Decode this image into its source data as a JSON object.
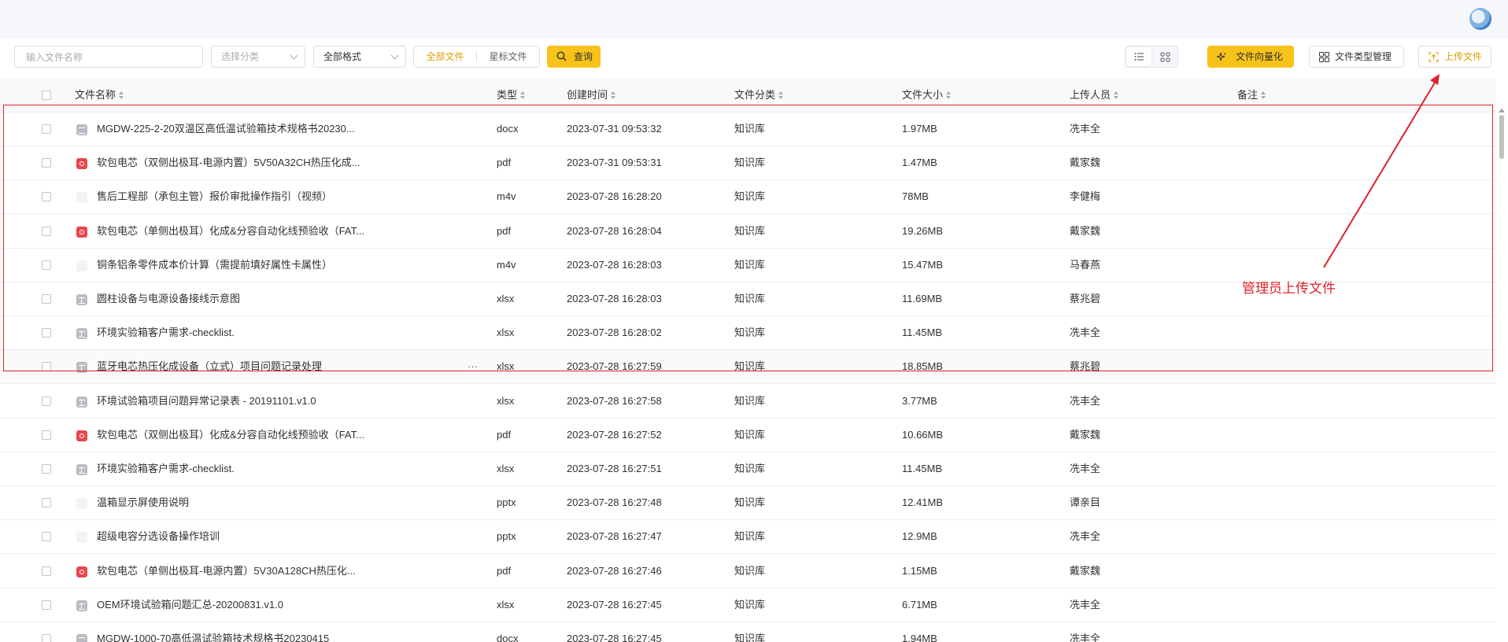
{
  "toolbar": {
    "search_placeholder": "输入文件名称",
    "category_placeholder": "选择分类",
    "format_value": "全部格式",
    "tab_all": "全部文件",
    "tab_star": "星标文件",
    "query_label": "查询",
    "vectorize_label": "文件向量化",
    "type_mgmt_label": "文件类型管理",
    "upload_label": "上传文件"
  },
  "table": {
    "columns": [
      "文件名称",
      "类型",
      "创建时间",
      "文件分类",
      "文件大小",
      "上传人员",
      "备注"
    ],
    "rows": [
      {
        "name": "MGDW-225-2-20双温区高低温试验箱技术规格书20230...",
        "icon": "doc",
        "type": "docx",
        "created": "2023-07-31 09:53:32",
        "category": "知识库",
        "size": "1.97MB",
        "uploader": "冼丰全",
        "note": ""
      },
      {
        "name": "软包电芯（双侧出极耳-电源内置）5V50A32CH热压化成...",
        "icon": "pdf",
        "type": "pdf",
        "created": "2023-07-31 09:53:31",
        "category": "知识库",
        "size": "1.47MB",
        "uploader": "戴家魏",
        "note": ""
      },
      {
        "name": "售后工程部（承包主管）报价审批操作指引（视频）",
        "icon": "vid",
        "type": "m4v",
        "created": "2023-07-28 16:28:20",
        "category": "知识库",
        "size": "78MB",
        "uploader": "李健梅",
        "note": ""
      },
      {
        "name": "软包电芯（单侧出极耳）化成&分容自动化线预验收（FAT...",
        "icon": "pdf",
        "type": "pdf",
        "created": "2023-07-28 16:28:04",
        "category": "知识库",
        "size": "19.26MB",
        "uploader": "戴家魏",
        "note": ""
      },
      {
        "name": "铜条铝条零件成本价计算（需提前填好属性卡属性）",
        "icon": "vid",
        "type": "m4v",
        "created": "2023-07-28 16:28:03",
        "category": "知识库",
        "size": "15.47MB",
        "uploader": "马春燕",
        "note": ""
      },
      {
        "name": "圆柱设备与电源设备接线示意图",
        "icon": "xls",
        "type": "xlsx",
        "created": "2023-07-28 16:28:03",
        "category": "知识库",
        "size": "11.69MB",
        "uploader": "蔡兆碧",
        "note": ""
      },
      {
        "name": "环境实验箱客户需求-checklist.",
        "icon": "xls",
        "type": "xlsx",
        "created": "2023-07-28 16:28:02",
        "category": "知识库",
        "size": "11.45MB",
        "uploader": "冼丰全",
        "note": ""
      },
      {
        "name": "蓝牙电芯热压化成设备（立式）项目问题记录处理",
        "icon": "xls",
        "type": "xlsx",
        "created": "2023-07-28 16:27:59",
        "category": "知识库",
        "size": "18.85MB",
        "uploader": "蔡兆碧",
        "note": ""
      },
      {
        "name": "环境试验箱项目问题异常记录表 - 20191101.v1.0",
        "icon": "xls",
        "type": "xlsx",
        "created": "2023-07-28 16:27:58",
        "category": "知识库",
        "size": "3.77MB",
        "uploader": "冼丰全",
        "note": ""
      },
      {
        "name": "软包电芯（双侧出极耳）化成&分容自动化线预验收（FAT...",
        "icon": "pdf",
        "type": "pdf",
        "created": "2023-07-28 16:27:52",
        "category": "知识库",
        "size": "10.66MB",
        "uploader": "戴家魏",
        "note": ""
      },
      {
        "name": "环境实验箱客户需求-checklist.",
        "icon": "xls",
        "type": "xlsx",
        "created": "2023-07-28 16:27:51",
        "category": "知识库",
        "size": "11.45MB",
        "uploader": "冼丰全",
        "note": ""
      },
      {
        "name": "温箱显示屏使用说明",
        "icon": "ppt",
        "type": "pptx",
        "created": "2023-07-28 16:27:48",
        "category": "知识库",
        "size": "12.41MB",
        "uploader": "谭亲目",
        "note": ""
      },
      {
        "name": "超级电容分选设备操作培训",
        "icon": "ppt",
        "type": "pptx",
        "created": "2023-07-28 16:27:47",
        "category": "知识库",
        "size": "12.9MB",
        "uploader": "冼丰全",
        "note": ""
      },
      {
        "name": "软包电芯（单侧出极耳-电源内置）5V30A128CH热压化...",
        "icon": "pdf",
        "type": "pdf",
        "created": "2023-07-28 16:27:46",
        "category": "知识库",
        "size": "1.15MB",
        "uploader": "戴家魏",
        "note": ""
      },
      {
        "name": "OEM环境试验箱问题汇总-20200831.v1.0",
        "icon": "xls",
        "type": "xlsx",
        "created": "2023-07-28 16:27:45",
        "category": "知识库",
        "size": "6.71MB",
        "uploader": "冼丰全",
        "note": ""
      },
      {
        "name": "MGDW-1000-70高低温试验箱技术规格书20230415",
        "icon": "doc",
        "type": "docx",
        "created": "2023-07-28 16:27:45",
        "category": "知识库",
        "size": "1.94MB",
        "uploader": "冼丰全",
        "note": ""
      }
    ],
    "row_more_glyph": "···"
  },
  "annotation": {
    "text": "管理员上传文件",
    "color": "#e0202a"
  },
  "colors": {
    "accent": "#f7c21a",
    "pdf": "#e5484d"
  }
}
